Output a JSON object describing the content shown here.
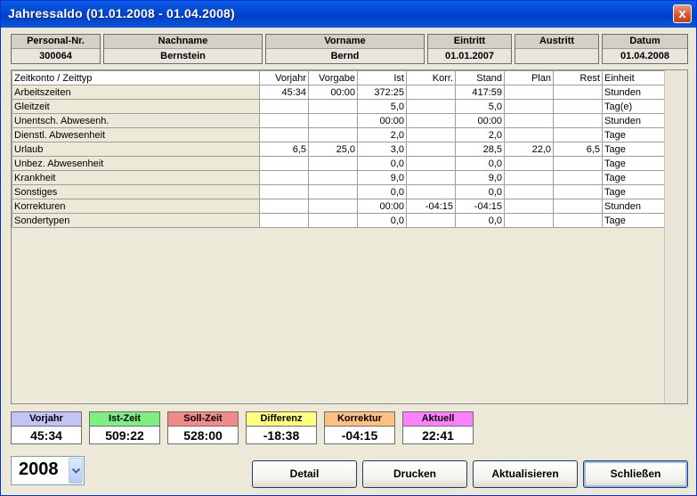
{
  "window": {
    "title": "Jahressaldo  (01.01.2008 - 01.04.2008)",
    "close_glyph": "x"
  },
  "header_fields": [
    {
      "label": "Personal-Nr.",
      "value": "300064"
    },
    {
      "label": "Nachname",
      "value": "Bernstein"
    },
    {
      "label": "Vorname",
      "value": "Bernd"
    },
    {
      "label": "Eintritt",
      "value": "01.01.2007"
    },
    {
      "label": "Austritt",
      "value": ""
    },
    {
      "label": "Datum",
      "value": "01.04.2008"
    }
  ],
  "grid": {
    "columns": [
      "Zeitkonto / Zeittyp",
      "Vorjahr",
      "Vorgabe",
      "Ist",
      "Korr.",
      "Stand",
      "Plan",
      "Rest",
      "Einheit"
    ],
    "rows": [
      [
        "Arbeitszeiten",
        "45:34",
        "00:00",
        "372:25",
        "",
        "417:59",
        "",
        "",
        "Stunden"
      ],
      [
        "Gleitzeit",
        "",
        "",
        "5,0",
        "",
        "5,0",
        "",
        "",
        "Tag(e)"
      ],
      [
        "Unentsch. Abwesenh.",
        "",
        "",
        "00:00",
        "",
        "00:00",
        "",
        "",
        "Stunden"
      ],
      [
        "Dienstl. Abwesenheit",
        "",
        "",
        "2,0",
        "",
        "2,0",
        "",
        "",
        "Tage"
      ],
      [
        "Urlaub",
        "6,5",
        "25,0",
        "3,0",
        "",
        "28,5",
        "22,0",
        "6,5",
        "Tage"
      ],
      [
        "Unbez. Abwesenheit",
        "",
        "",
        "0,0",
        "",
        "0,0",
        "",
        "",
        "Tage"
      ],
      [
        "Krankheit",
        "",
        "",
        "9,0",
        "",
        "9,0",
        "",
        "",
        "Tage"
      ],
      [
        "Sonstiges",
        "",
        "",
        "0,0",
        "",
        "0,0",
        "",
        "",
        "Tage"
      ],
      [
        "Korrekturen",
        "",
        "",
        "00:00",
        "-04:15",
        "-04:15",
        "",
        "",
        "Stunden"
      ],
      [
        "Sondertypen",
        "",
        "",
        "0,0",
        "",
        "0,0",
        "",
        "",
        "Tage"
      ]
    ]
  },
  "summary": [
    {
      "label": "Vorjahr",
      "value": "45:34",
      "color": "#c3c3f5"
    },
    {
      "label": "Ist-Zeit",
      "value": "509:22",
      "color": "#7ff07f"
    },
    {
      "label": "Soll-Zeit",
      "value": "528:00",
      "color": "#f28a8a"
    },
    {
      "label": "Differenz",
      "value": "-18:38",
      "color": "#ffff80"
    },
    {
      "label": "Korrektur",
      "value": "-04:15",
      "color": "#ffc080"
    },
    {
      "label": "Aktuell",
      "value": "22:41",
      "color": "#ff80ff"
    }
  ],
  "year_select": {
    "value": "2008"
  },
  "buttons": {
    "detail": "Detail",
    "drucken": "Drucken",
    "aktualisieren": "Aktualisieren",
    "schliessen": "Schließen"
  }
}
